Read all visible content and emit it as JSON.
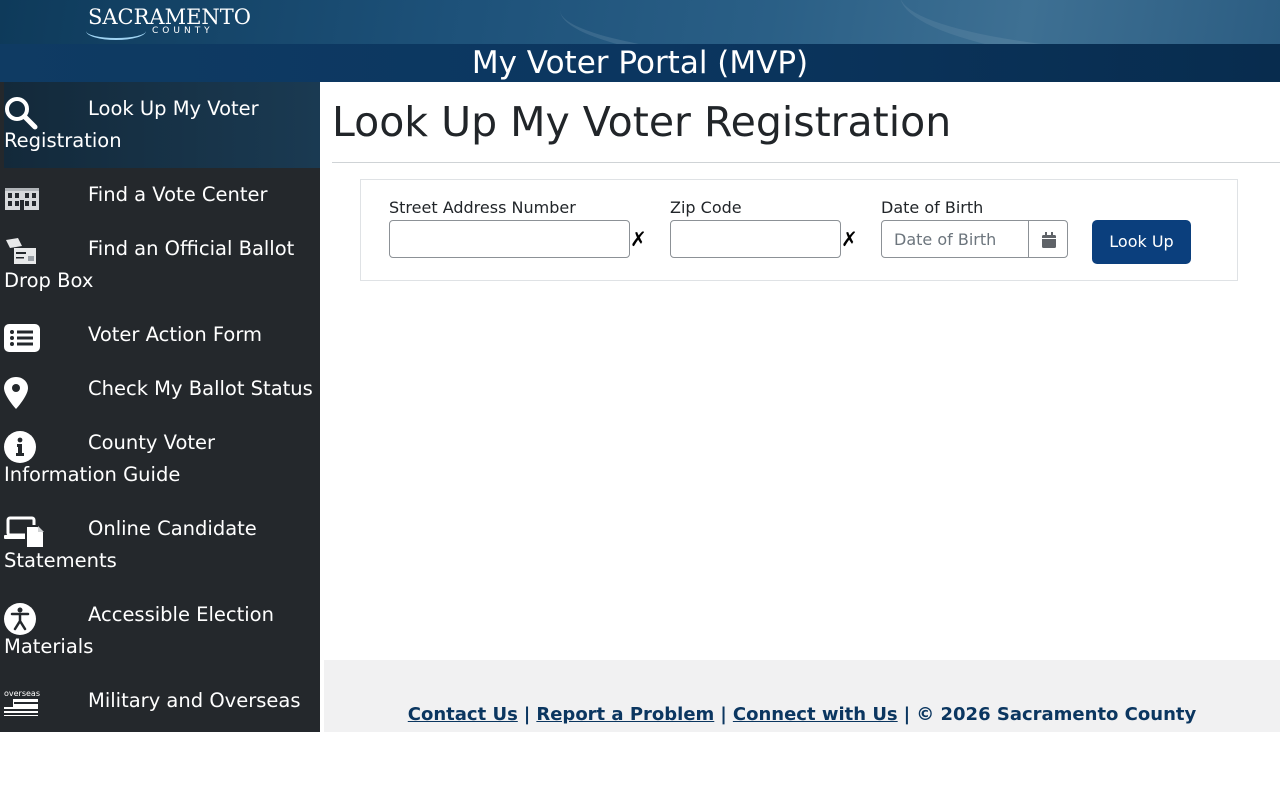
{
  "header": {
    "logo_name": "SACRAMENTO",
    "logo_sub": "COUNTY",
    "title": "My Voter Portal (MVP)"
  },
  "sidebar": {
    "items": [
      {
        "label": "Look Up My Voter Registration",
        "icon": "search-icon",
        "active": true
      },
      {
        "label": "Find a Vote Center",
        "icon": "building-icon",
        "active": false
      },
      {
        "label": "Find an Official Ballot Drop Box",
        "icon": "ballot-drop-box-icon",
        "active": false
      },
      {
        "label": "Voter Action Form",
        "icon": "list-icon",
        "active": false
      },
      {
        "label": "Check My Ballot Status",
        "icon": "map-marker-icon",
        "active": false
      },
      {
        "label": "County Voter Information Guide",
        "icon": "info-icon",
        "active": false
      },
      {
        "label": "Online Candidate Statements",
        "icon": "device-document-icon",
        "active": false
      },
      {
        "label": "Accessible Election Materials",
        "icon": "accessibility-icon",
        "active": false
      },
      {
        "label": "Military and Overseas",
        "icon": "overseas-vote-icon",
        "active": false
      }
    ]
  },
  "main": {
    "title": "Look Up My Voter Registration",
    "form": {
      "street_label": "Street Address Number",
      "street_value": "",
      "zip_label": "Zip Code",
      "zip_value": "",
      "dob_label": "Date of Birth",
      "dob_placeholder": "Date of Birth",
      "clear_symbol": "✗",
      "submit_label": "Look Up"
    }
  },
  "footer": {
    "contact": "Contact Us",
    "report": "Report a Problem",
    "connect": "Connect with Us",
    "separator": "|",
    "copyright": "© 2026 Sacramento County"
  },
  "colors": {
    "sidebar_bg": "#24282c",
    "header_dark": "#0b3660",
    "button_primary": "#0b3f7d",
    "footer_bg": "#f1f1f2"
  }
}
